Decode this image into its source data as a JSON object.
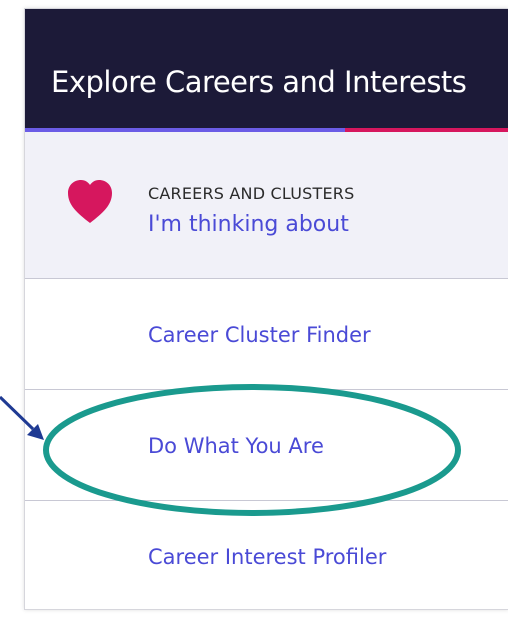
{
  "header": {
    "title": "Explore Careers and Interests",
    "accent_left": "#6b5ce6",
    "accent_right": "#d6175e",
    "background": "#1c1a38"
  },
  "thinking": {
    "icon": "heart-icon",
    "kicker": "CAREERS AND CLUSTERS",
    "link": "I'm thinking about"
  },
  "nav": {
    "items": [
      {
        "label": "Career Cluster Finder"
      },
      {
        "label": "Do What You Are"
      },
      {
        "label": "Career Interest Profiler"
      }
    ]
  },
  "annotation": {
    "highlight_color": "#1a9a8e",
    "highlighted_item": "Do What You Are"
  }
}
